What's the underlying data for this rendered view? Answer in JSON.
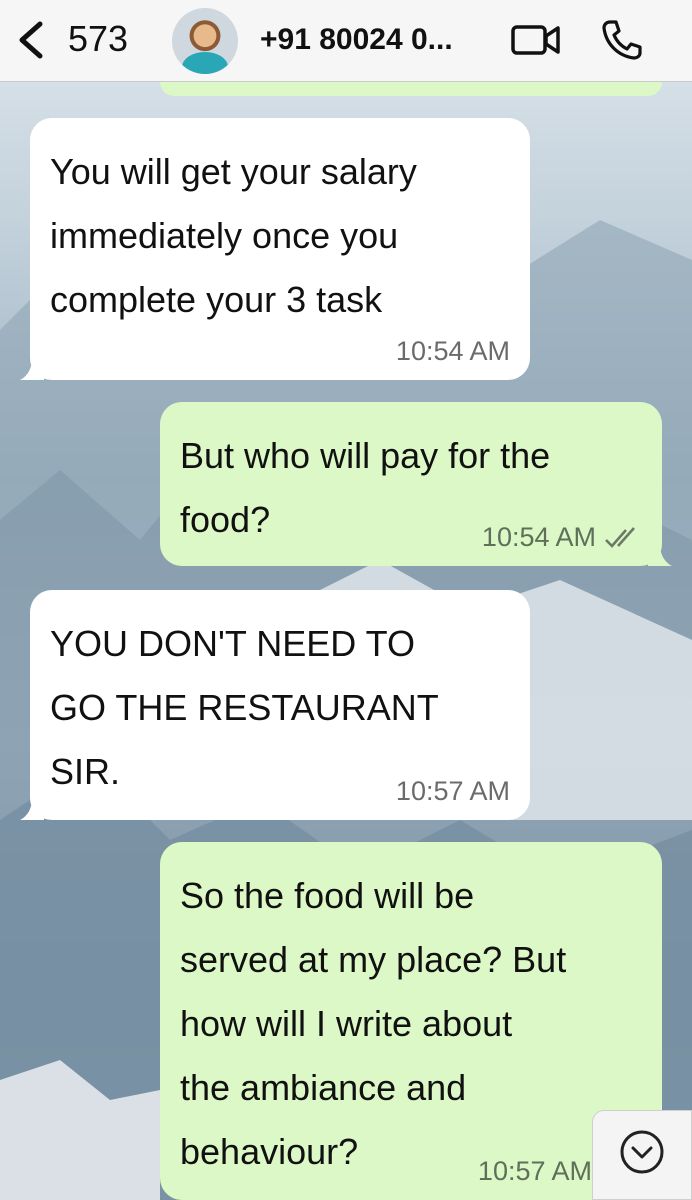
{
  "header": {
    "back_count": "573",
    "contact_name": "+91 80024 0...",
    "icons": [
      "back-chevron-icon",
      "video-call-icon",
      "voice-call-icon"
    ]
  },
  "messages": [
    {
      "direction": "incoming",
      "lines": [
        "You will get your salary",
        "immediately once you",
        "complete your 3 task"
      ],
      "time": "10:54 AM"
    },
    {
      "direction": "outgoing",
      "lines": [
        "But who will pay for the",
        "food?"
      ],
      "time": "10:54 AM",
      "status": "read-ticks-icon"
    },
    {
      "direction": "incoming",
      "lines": [
        "YOU DON'T NEED TO",
        "GO THE RESTAURANT",
        "SIR."
      ],
      "time": "10:57 AM"
    },
    {
      "direction": "outgoing",
      "lines": [
        "So the food will be",
        "served at my place? But",
        "how will I write about",
        "the ambiance and",
        "behaviour?"
      ],
      "time": "10:57 AM"
    }
  ],
  "colors": {
    "incoming_bubble": "#ffffff",
    "outgoing_bubble": "#dcf8c6",
    "header_bg": "#f6f6f6"
  }
}
